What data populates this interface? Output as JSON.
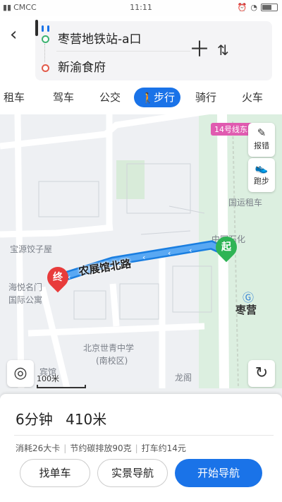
{
  "status": {
    "carrier": "CMCC",
    "time": "11:11"
  },
  "route": {
    "from": "枣营地铁站-a口",
    "to": "新渝食府"
  },
  "tabs": [
    "租车",
    "驾车",
    "公交",
    "步行",
    "骑行",
    "火车"
  ],
  "active_tab": "步行",
  "map": {
    "road_name": "农展馆北路",
    "labels": {
      "subway_line": "14号线东段",
      "zaoying": "枣营",
      "guoyun": "国运租车",
      "sinopec": "中国石化",
      "baoyuan": "宝源饺子屋",
      "haiyue1": "海悦名门",
      "haiyue2": "国际公寓",
      "school1": "北京世青中学",
      "school2": "(南校区)",
      "hotel": "宾馆",
      "longge": "龙阁"
    },
    "start_marker": "起",
    "end_marker": "终",
    "report_label": "报错",
    "run_label": "跑步",
    "scale": "100米"
  },
  "summary": {
    "time": "6分钟",
    "distance": "410米"
  },
  "info": {
    "calories": "消耗26大卡",
    "carbon": "节约碳排放90克",
    "taxi": "打车约14元"
  },
  "buttons": {
    "bike": "找单车",
    "ar_nav": "实景导航",
    "start_nav": "开始导航"
  },
  "colors": {
    "accent": "#1a73e8",
    "start": "#2fb455",
    "end": "#e83b3b"
  }
}
